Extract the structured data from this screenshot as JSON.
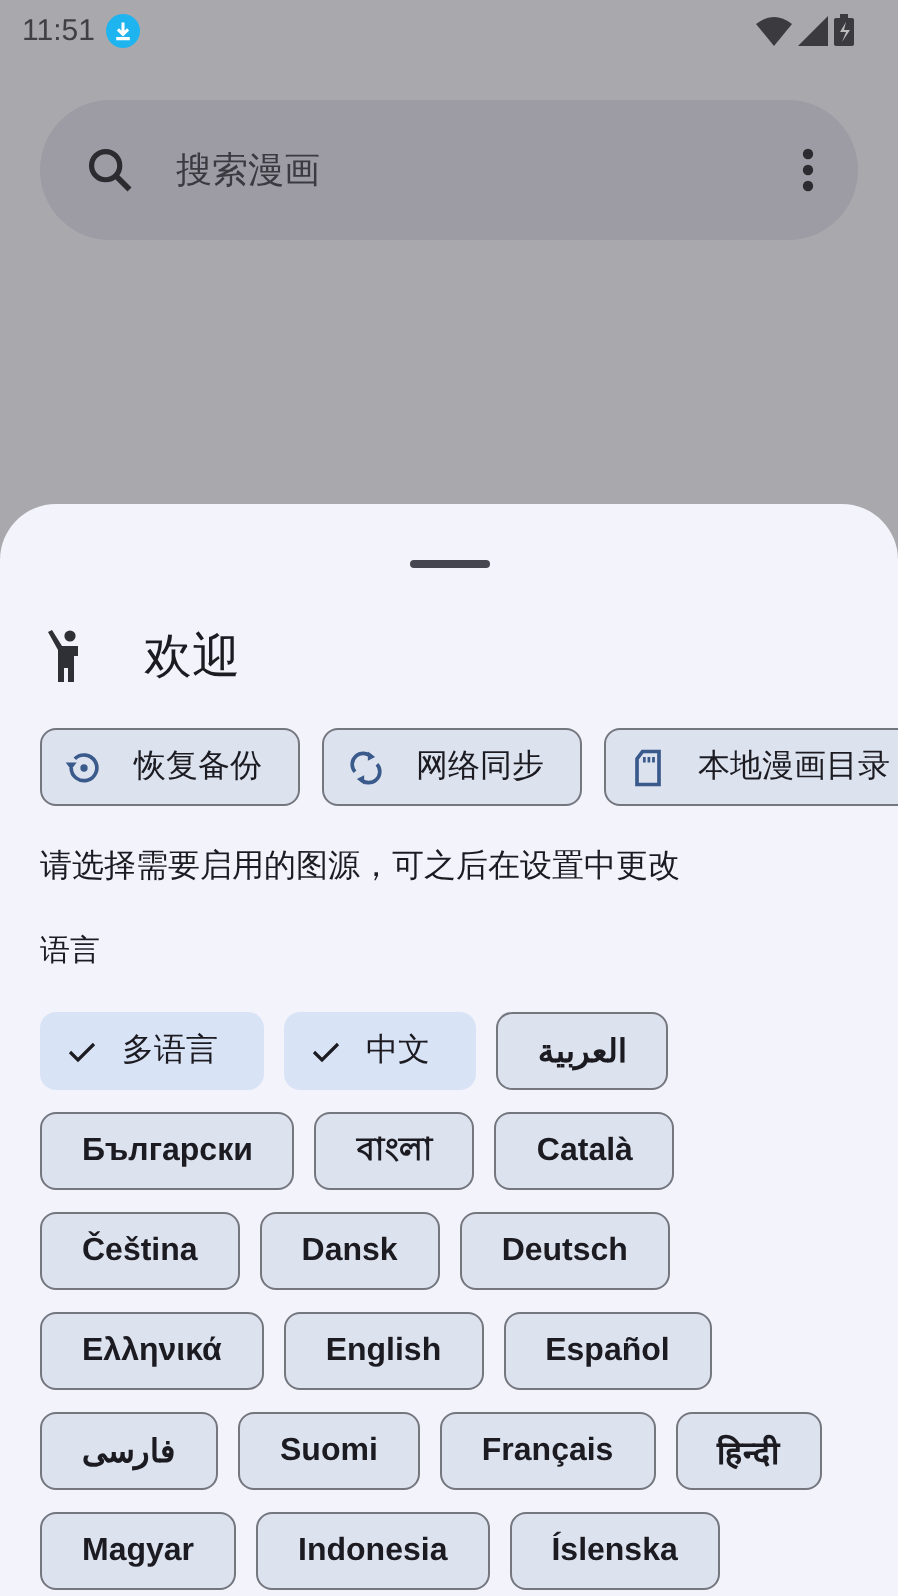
{
  "status_bar": {
    "time": "11:51"
  },
  "search": {
    "placeholder": "搜索漫画"
  },
  "sheet": {
    "title": "欢迎",
    "actions": [
      {
        "kind": "restore",
        "label": "恢复备份"
      },
      {
        "kind": "sync",
        "label": "网络同步"
      },
      {
        "kind": "local",
        "label": "本地漫画目录"
      }
    ],
    "description": "请选择需要启用的图源，可之后在设置中更改",
    "language_label": "语言",
    "languages": [
      {
        "label": "多语言",
        "selected": true
      },
      {
        "label": "中文",
        "selected": true
      },
      {
        "label": "العربية",
        "selected": false
      },
      {
        "label": "Български",
        "selected": false
      },
      {
        "label": "বাংলা",
        "selected": false
      },
      {
        "label": "Català",
        "selected": false
      },
      {
        "label": "Čeština",
        "selected": false
      },
      {
        "label": "Dansk",
        "selected": false
      },
      {
        "label": "Deutsch",
        "selected": false
      },
      {
        "label": "Ελληνικά",
        "selected": false
      },
      {
        "label": "English",
        "selected": false
      },
      {
        "label": "Español",
        "selected": false
      },
      {
        "label": "فارسی",
        "selected": false
      },
      {
        "label": "Suomi",
        "selected": false
      },
      {
        "label": "Français",
        "selected": false
      },
      {
        "label": "हिन्दी",
        "selected": false
      },
      {
        "label": "Magyar",
        "selected": false
      },
      {
        "label": "Indonesia",
        "selected": false
      },
      {
        "label": "Íslenska",
        "selected": false
      }
    ]
  }
}
